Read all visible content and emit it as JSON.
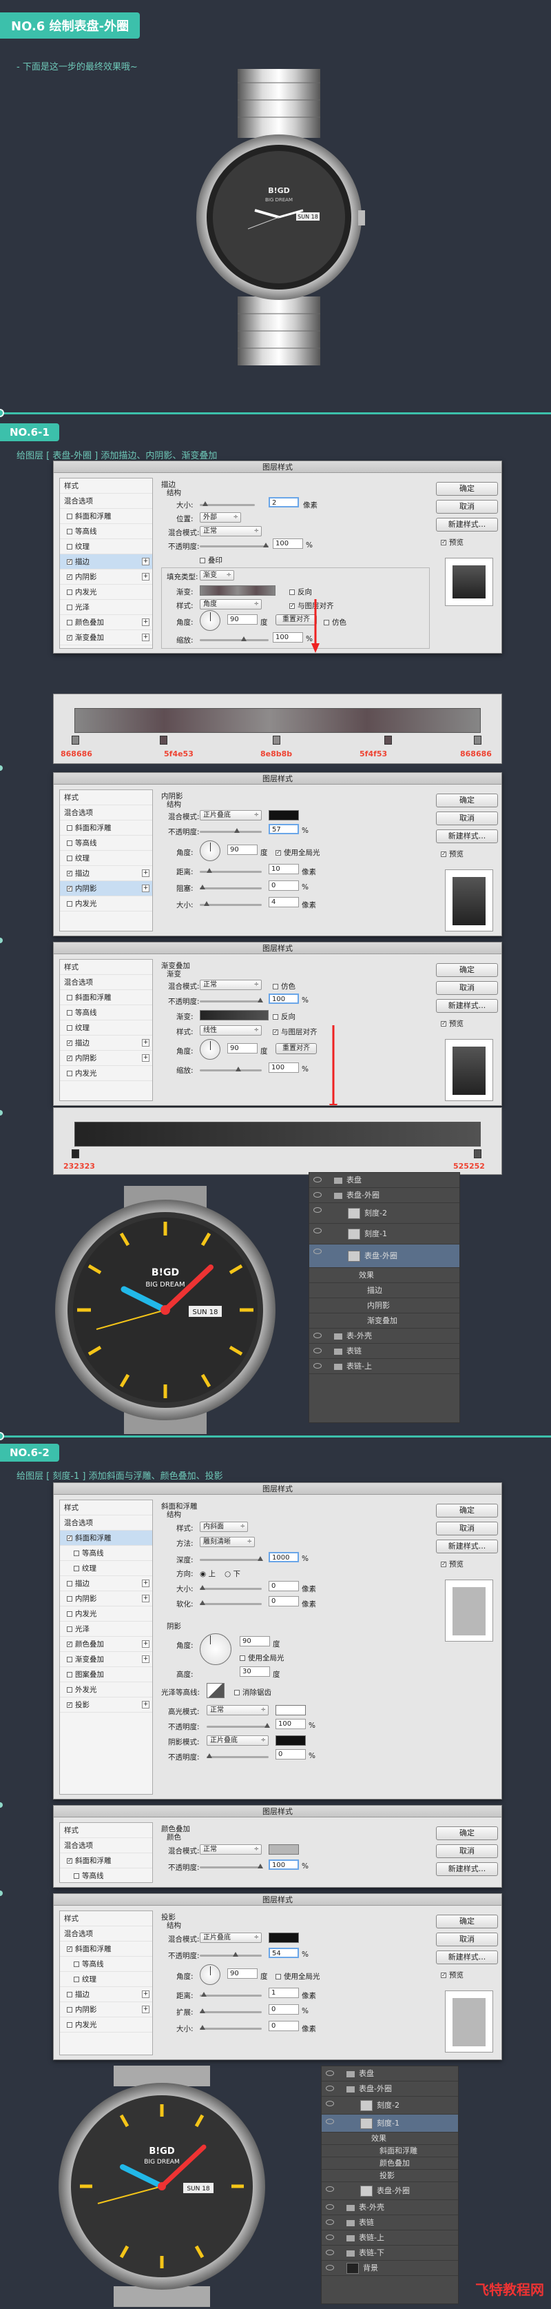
{
  "header": {
    "title": "NO.6 绘制表盘-外圈",
    "note": "- 下面是这一步的最终效果哦~"
  },
  "watch": {
    "brand_top": "B!GD",
    "brand_bottom": "BIG DREAM",
    "date": "SUN 18"
  },
  "section1": {
    "title": "NO.6-1",
    "desc": "给图层 [ 表盘-外圈 ] 添加描边、内阴影、渐变叠加"
  },
  "section2": {
    "title": "NO.6-2",
    "desc": "给图层 [ 刻度-1 ] 添加斜面与浮雕、颜色叠加、投影"
  },
  "dialog_common": {
    "title": "图层样式",
    "ok": "确定",
    "cancel": "取消",
    "new_style": "新建样式...",
    "preview": "预览",
    "style_items": [
      "样式",
      "混合选项",
      "斜面和浮雕",
      "等高线",
      "纹理",
      "描边",
      "内阴影",
      "内发光",
      "光泽",
      "颜色叠加",
      "渐变叠加",
      "图案叠加",
      "外发光",
      "投影"
    ]
  },
  "stroke_dialog": {
    "group": "描边",
    "structure": "结构",
    "size_label": "大小:",
    "size": "2",
    "size_unit": "像素",
    "position_label": "位置:",
    "position": "外部",
    "blend_label": "混合模式:",
    "blend": "正常",
    "opacity_label": "不透明度:",
    "opacity": "100",
    "pct": "%",
    "emboss_label": "叠印",
    "fill_label": "填充类型:",
    "fill": "渐变",
    "gradient_label": "渐变:",
    "reverse": "反向",
    "style_label": "样式:",
    "style": "角度",
    "align": "与图层对齐",
    "angle_label": "角度:",
    "angle": "90",
    "deg": "度",
    "reset": "重置对齐",
    "dither": "仿色",
    "scale_label": "缩放:",
    "scale": "100"
  },
  "gradient1": {
    "stops": [
      "868686",
      "5f4e53",
      "8e8b8b",
      "5f4f53",
      "868686"
    ]
  },
  "inner_shadow": {
    "group": "内阴影",
    "structure": "结构",
    "blend_label": "混合模式:",
    "blend": "正片叠底",
    "opacity_label": "不透明度:",
    "opacity": "57",
    "pct": "%",
    "angle_label": "角度:",
    "angle": "90",
    "deg": "度",
    "global": "使用全局光",
    "distance_label": "距离:",
    "distance": "10",
    "px": "像素",
    "choke_label": "阻塞:",
    "choke": "0",
    "pct2": "%",
    "size_label": "大小:",
    "size": "4"
  },
  "gradient_overlay": {
    "group": "渐变叠加",
    "sub": "渐变",
    "blend_label": "混合模式:",
    "blend": "正常",
    "dither": "仿色",
    "opacity_label": "不透明度:",
    "opacity": "100",
    "pct": "%",
    "gradient_label": "渐变:",
    "reverse": "反向",
    "style_label": "样式:",
    "style": "线性",
    "align": "与图层对齐",
    "angle_label": "角度:",
    "angle": "90",
    "deg": "度",
    "reset": "重置对齐",
    "scale_label": "缩放:",
    "scale": "100"
  },
  "gradient2": {
    "stops": [
      "232323",
      "525252"
    ]
  },
  "layers1": [
    {
      "name": "表盘",
      "kind": "folder"
    },
    {
      "name": "表盘-外圈",
      "kind": "folder"
    },
    {
      "name": "刻度-2",
      "kind": "layer"
    },
    {
      "name": "刻度-1",
      "kind": "layer"
    },
    {
      "name": "表盘-外圈",
      "kind": "layer-sel"
    },
    {
      "name": "效果",
      "kind": "fx"
    },
    {
      "name": "描边",
      "kind": "fx2"
    },
    {
      "name": "内阴影",
      "kind": "fx2"
    },
    {
      "name": "渐变叠加",
      "kind": "fx2"
    },
    {
      "name": "表-外壳",
      "kind": "folder"
    },
    {
      "name": "表链",
      "kind": "folder"
    },
    {
      "name": "表链-上",
      "kind": "folder"
    }
  ],
  "bevel": {
    "group": "斜面和浮雕",
    "structure": "结构",
    "style_label": "样式:",
    "style": "内斜面",
    "method_label": "方法:",
    "method": "雕刻清晰",
    "depth_label": "深度:",
    "depth": "1000",
    "pct": "%",
    "dir_label": "方向:",
    "up": "上",
    "down": "下",
    "size_label": "大小:",
    "size": "0",
    "px": "像素",
    "soften_label": "软化:",
    "soften": "0",
    "shading": "阴影",
    "angle_label": "角度:",
    "angle": "90",
    "deg": "度",
    "global": "使用全局光",
    "altitude_label": "高度:",
    "altitude": "30",
    "gloss_label": "光泽等高线:",
    "anti": "消除锯齿",
    "hl_label": "高光模式:",
    "hl": "正常",
    "hl_op_label": "不透明度:",
    "hl_op": "100",
    "sh_label": "阴影模式:",
    "sh": "正片叠底",
    "sh_op_label": "不透明度:",
    "sh_op": "0"
  },
  "color_overlay": {
    "group": "颜色叠加",
    "sub": "颜色",
    "blend_label": "混合模式:",
    "blend": "正常",
    "opacity_label": "不透明度:",
    "opacity": "100",
    "pct": "%"
  },
  "drop_shadow": {
    "group": "投影",
    "structure": "结构",
    "blend_label": "混合模式:",
    "blend": "正片叠底",
    "opacity_label": "不透明度:",
    "opacity": "54",
    "pct": "%",
    "angle_label": "角度:",
    "angle": "90",
    "deg": "度",
    "global": "使用全局光",
    "distance_label": "距离:",
    "distance": "1",
    "px": "像素",
    "spread_label": "扩展:",
    "spread": "0",
    "pct2": "%",
    "size_label": "大小:",
    "size": "0"
  },
  "layers2": [
    {
      "name": "表盘",
      "kind": "folder"
    },
    {
      "name": "表盘-外圈",
      "kind": "folder"
    },
    {
      "name": "刻度-2",
      "kind": "layer"
    },
    {
      "name": "刻度-1",
      "kind": "layer-sel"
    },
    {
      "name": "效果",
      "kind": "fx"
    },
    {
      "name": "斜面和浮雕",
      "kind": "fx2"
    },
    {
      "name": "颜色叠加",
      "kind": "fx2"
    },
    {
      "name": "投影",
      "kind": "fx2"
    },
    {
      "name": "表盘-外圈",
      "kind": "layer"
    },
    {
      "name": "表-外壳",
      "kind": "folder"
    },
    {
      "name": "表链",
      "kind": "folder"
    },
    {
      "name": "表链-上",
      "kind": "folder"
    },
    {
      "name": "表链-下",
      "kind": "folder"
    },
    {
      "name": "背景",
      "kind": "layer"
    }
  ],
  "footer_watermark": "飞特教程网"
}
